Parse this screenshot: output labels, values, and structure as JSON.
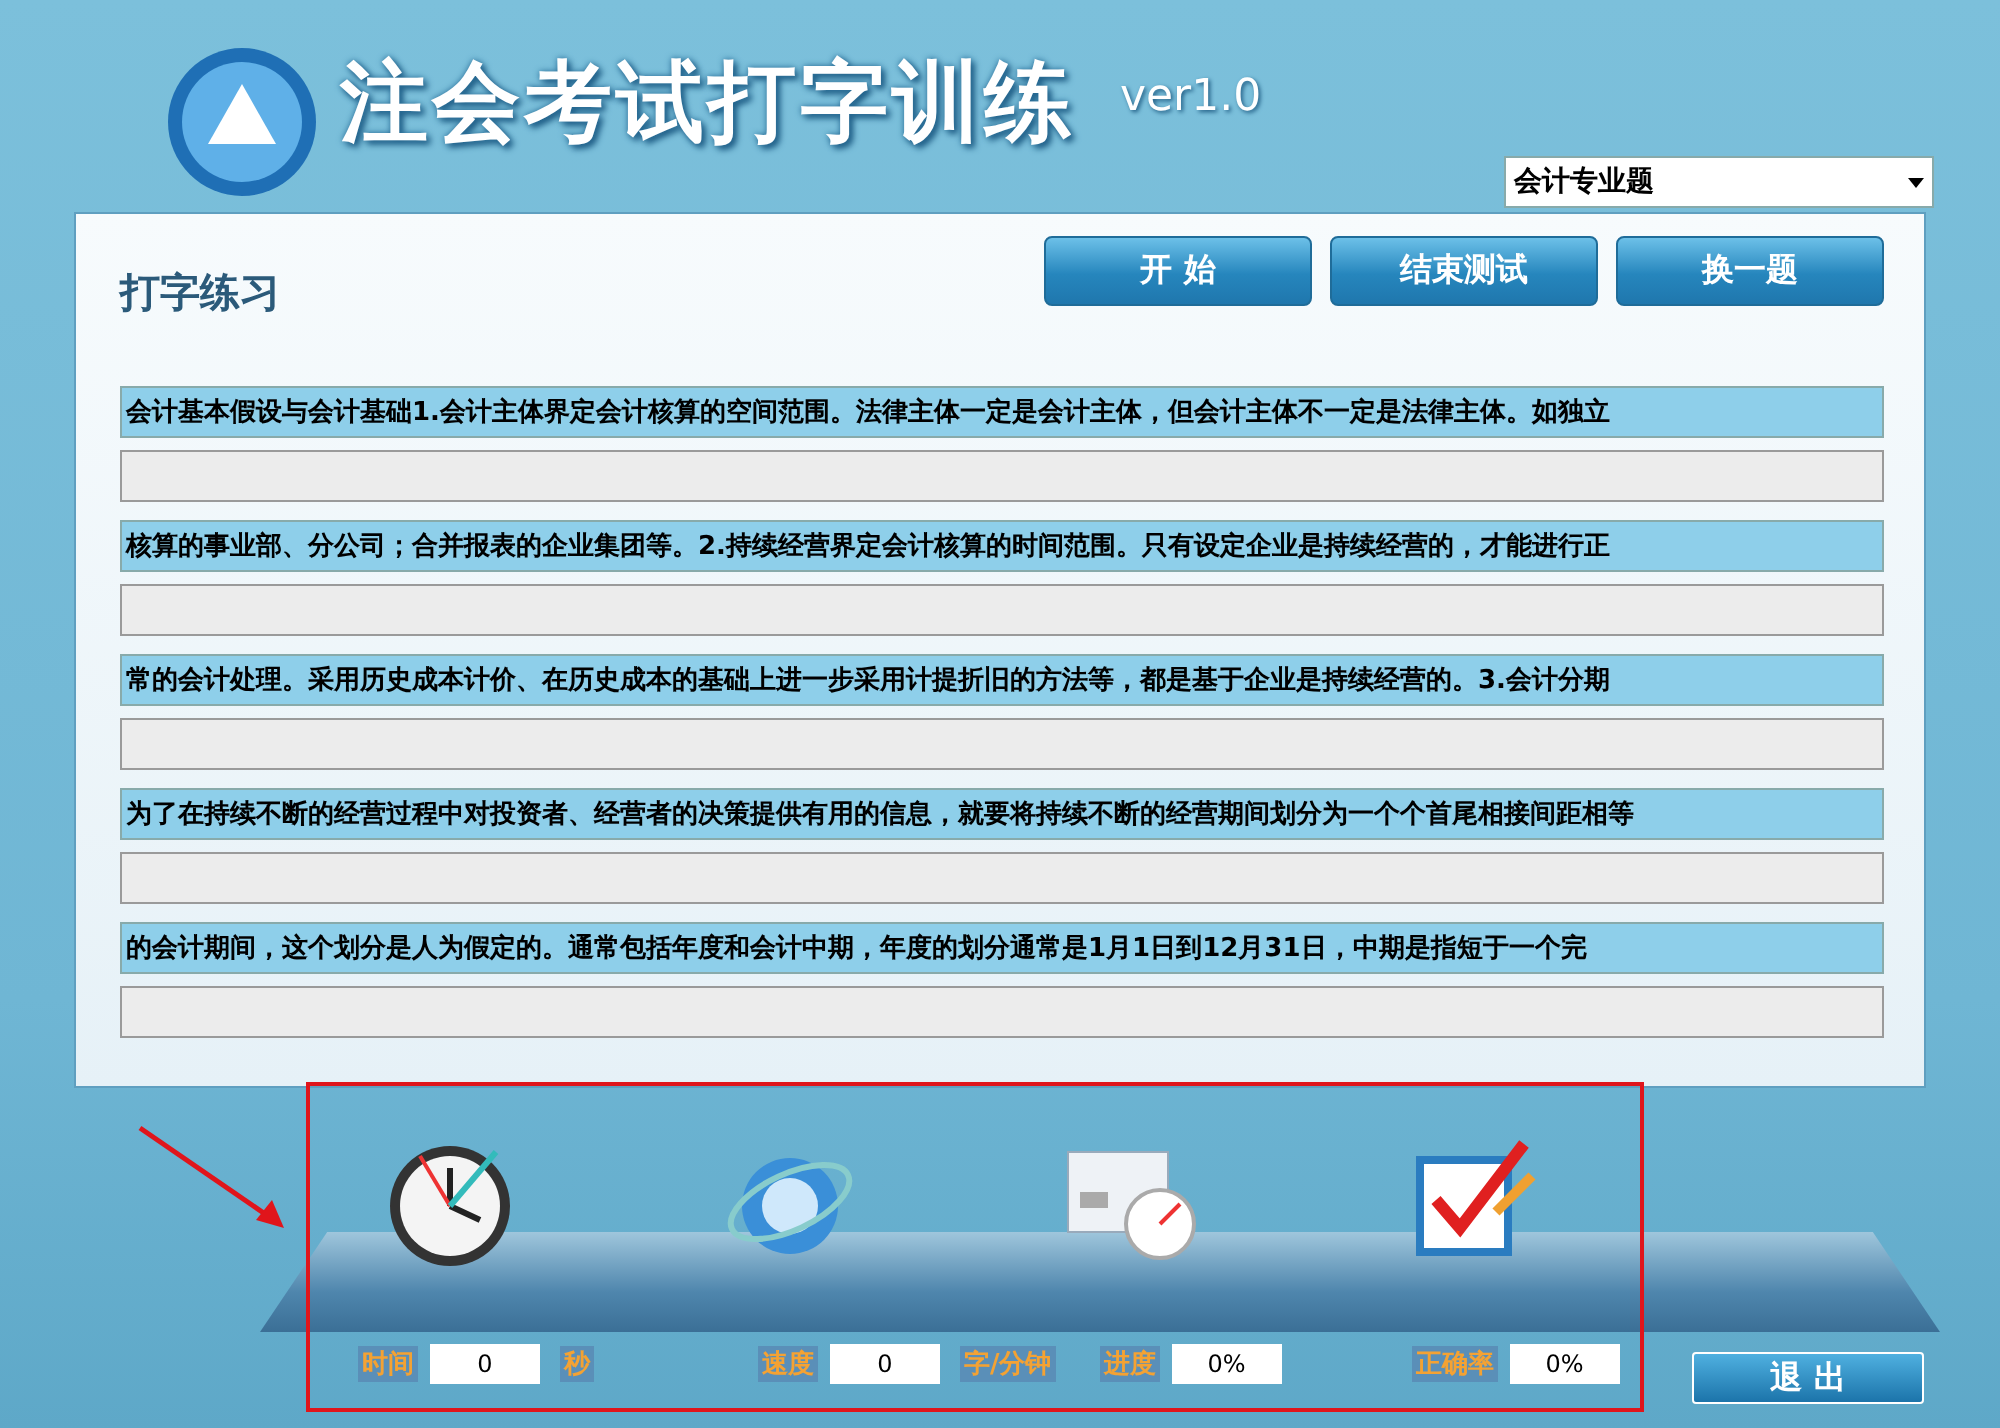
{
  "app": {
    "title": "注会考试打字训练",
    "version": "ver1.0"
  },
  "category_select": {
    "value": "会计专业题"
  },
  "panel": {
    "title": "打字练习",
    "buttons": [
      "开 始",
      "结束测试",
      "换一题"
    ]
  },
  "lines": [
    "会计基本假设与会计基础1.会计主体界定会计核算的空间范围。法律主体一定是会计主体，但会计主体不一定是法律主体。如独立",
    "核算的事业部、分公司；合并报表的企业集团等。2.持续经营界定会计核算的时间范围。只有设定企业是持续经营的，才能进行正",
    "常的会计处理。采用历史成本计价、在历史成本的基础上进一步采用计提折旧的方法等，都是基于企业是持续经营的。3.会计分期",
    "为了在持续不断的经营过程中对投资者、经营者的决策提供有用的信息，就要将持续不断的经营期间划分为一个个首尾相接间距相等",
    "的会计期间，这个划分是人为假定的。通常包括年度和会计中期，年度的划分通常是1月1日到12月31日，中期是指短于一个完"
  ],
  "tools": [
    {
      "kind": "clock"
    },
    {
      "kind": "globe"
    },
    {
      "kind": "gauge"
    },
    {
      "kind": "check"
    }
  ],
  "stats": [
    {
      "label": "时间",
      "value": "0",
      "unit": "秒"
    },
    {
      "label": "速度",
      "value": "0",
      "unit": "字/分钟"
    },
    {
      "label": "进度",
      "value": "0%"
    },
    {
      "label": "正确率",
      "value": "0%"
    }
  ],
  "exit_button": "退 出",
  "annotation": {
    "frame": true,
    "arrow": true
  }
}
